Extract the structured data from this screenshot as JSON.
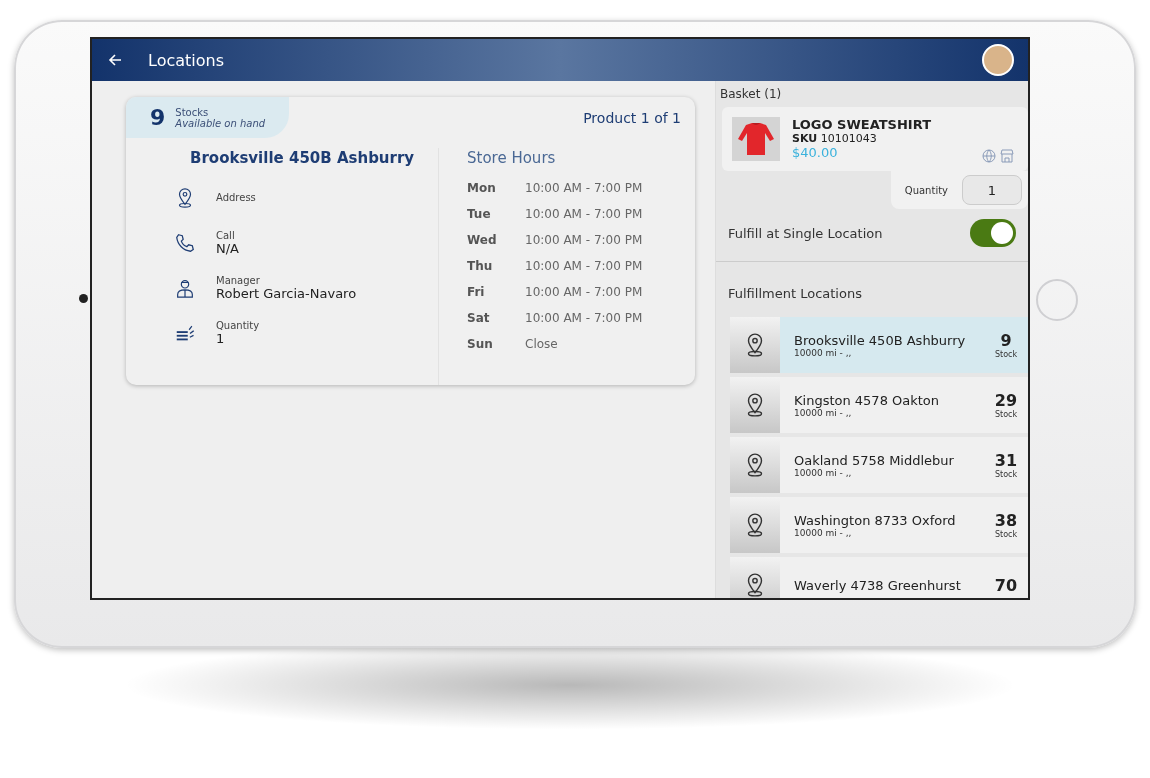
{
  "header": {
    "title": "Locations"
  },
  "stock_card": {
    "count": "9",
    "label": "Stocks",
    "sublabel": "Available on hand",
    "product": "Product 1 of 1"
  },
  "store": {
    "name": "Brooksville 450B Ashburry",
    "details": [
      {
        "kind": "pin",
        "label": "Address"
      },
      {
        "kind": "phone",
        "label": "Call",
        "value": "N/A"
      },
      {
        "kind": "person",
        "label": "Manager",
        "value": "Robert Garcia-Navaro"
      },
      {
        "kind": "stack",
        "label": "Quantity",
        "value": "1"
      }
    ]
  },
  "hours": {
    "title": "Store Hours",
    "days": [
      {
        "day": "Mon",
        "time": "10:00 AM - 7:00 PM"
      },
      {
        "day": "Tue",
        "time": "10:00 AM - 7:00 PM"
      },
      {
        "day": "Wed",
        "time": "10:00 AM - 7:00 PM"
      },
      {
        "day": "Thu",
        "time": "10:00 AM - 7:00 PM"
      },
      {
        "day": "Fri",
        "time": "10:00 AM - 7:00 PM"
      },
      {
        "day": "Sat",
        "time": "10:00 AM - 7:00 PM"
      },
      {
        "day": "Sun",
        "time": "Close"
      }
    ]
  },
  "basket": {
    "title": "Basket (1)",
    "item": {
      "name": "LOGO SWEATSHIRT",
      "sku_label": "SKU",
      "sku": "10101043",
      "price": "$40.00"
    },
    "quantity_label": "Quantity",
    "quantity": "1"
  },
  "single_location": {
    "label": "Fulfill at Single Location",
    "on": true
  },
  "fulfillment": {
    "title": "Fulfillment Locations",
    "locations": [
      {
        "name": "Brooksville 450B Ashburry",
        "distance": "10000 mi - ,,",
        "stock": "9",
        "stock_label": "Stock",
        "selected": true
      },
      {
        "name": "Kingston 4578 Oakton",
        "distance": "10000 mi - ,,",
        "stock": "29",
        "stock_label": "Stock",
        "selected": false
      },
      {
        "name": "Oakland 5758 Middlebur",
        "distance": "10000 mi - ,,",
        "stock": "31",
        "stock_label": "Stock",
        "selected": false
      },
      {
        "name": "Washington 8733 Oxford",
        "distance": "10000 mi - ,,",
        "stock": "38",
        "stock_label": "Stock",
        "selected": false
      },
      {
        "name": "Waverly 4738 Greenhurst",
        "stock": "70",
        "selected": false
      }
    ]
  }
}
